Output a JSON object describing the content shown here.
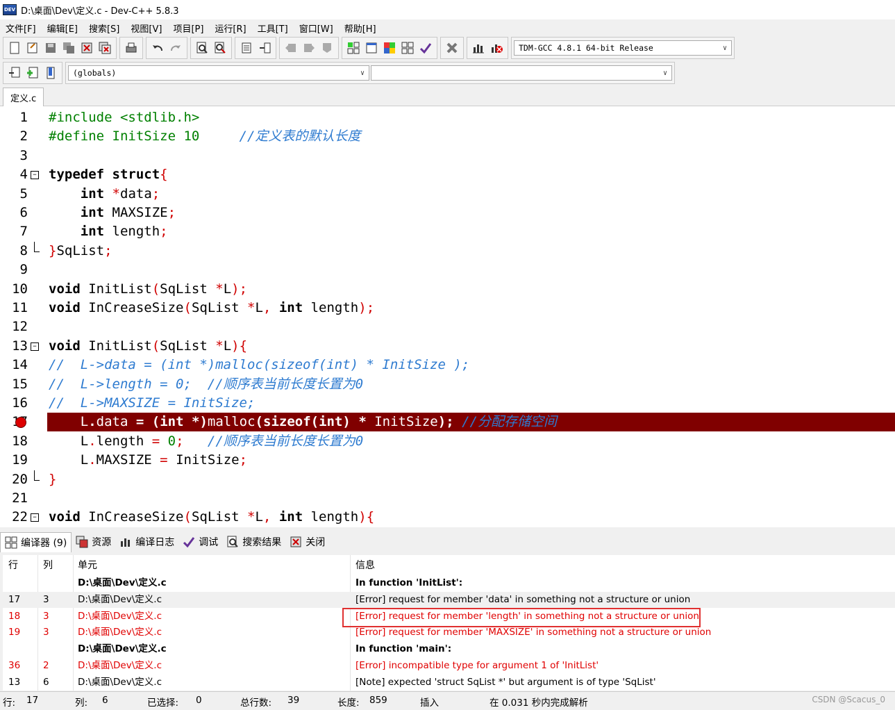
{
  "window": {
    "title": "D:\\桌面\\Dev\\定义.c - Dev-C++ 5.8.3",
    "icon_label": "DEV"
  },
  "menu": [
    "文件[F]",
    "编辑[E]",
    "搜索[S]",
    "视图[V]",
    "项目[P]",
    "运行[R]",
    "工具[T]",
    "窗口[W]",
    "帮助[H]"
  ],
  "toolbar": {
    "compiler_select": "TDM-GCC 4.8.1 64-bit Release",
    "scope_select": "(globals)",
    "member_select": ""
  },
  "file_tab": "定义.c",
  "editor": {
    "lines": [
      {
        "n": "1",
        "text": "#include <stdlib.h>"
      },
      {
        "n": "2",
        "text": "#define InitSize 10     //定义表的默认长度"
      },
      {
        "n": "3",
        "text": ""
      },
      {
        "n": "4",
        "text": "typedef struct{"
      },
      {
        "n": "5",
        "text": "    int *data;"
      },
      {
        "n": "6",
        "text": "    int MAXSIZE;"
      },
      {
        "n": "7",
        "text": "    int length;"
      },
      {
        "n": "8",
        "text": "}SqList;"
      },
      {
        "n": "9",
        "text": ""
      },
      {
        "n": "10",
        "text": "void InitList(SqList *L);"
      },
      {
        "n": "11",
        "text": "void InCreaseSize(SqList *L, int length);"
      },
      {
        "n": "12",
        "text": ""
      },
      {
        "n": "13",
        "text": "void InitList(SqList *L){"
      },
      {
        "n": "14",
        "text": "//  L->data = (int *)malloc(sizeof(int) * InitSize );"
      },
      {
        "n": "15",
        "text": "//  L->length = 0;  //顺序表当前长度长置为0"
      },
      {
        "n": "16",
        "text": "//  L->MAXSIZE = InitSize;"
      },
      {
        "n": "17",
        "text": "    L.data = (int *)malloc(sizeof(int) * InitSize); //分配存储空间"
      },
      {
        "n": "18",
        "text": "    L.length = 0;   //顺序表当前长度长置为0"
      },
      {
        "n": "19",
        "text": "    L.MAXSIZE = InitSize;"
      },
      {
        "n": "20",
        "text": "}"
      },
      {
        "n": "21",
        "text": ""
      },
      {
        "n": "22",
        "text": "void InCreaseSize(SqList *L, int length){"
      }
    ],
    "error_line": "17"
  },
  "bottom_tabs": [
    "编译器 (9)",
    "资源",
    "编译日志",
    "调试",
    "搜索结果",
    "关闭"
  ],
  "messages": {
    "headers": [
      "行",
      "列",
      "单元",
      "信息"
    ],
    "rows": [
      {
        "row": "",
        "col": "",
        "unit": "D:\\桌面\\Dev\\定义.c",
        "msg": "In function 'InitList':",
        "style": "bold"
      },
      {
        "row": "17",
        "col": "3",
        "unit": "D:\\桌面\\Dev\\定义.c",
        "msg": "[Error] request for member 'data' in something not a structure or union",
        "style": "normal"
      },
      {
        "row": "18",
        "col": "3",
        "unit": "D:\\桌面\\Dev\\定义.c",
        "msg": "[Error] request for member 'length' in something not a structure or union",
        "style": "red"
      },
      {
        "row": "19",
        "col": "3",
        "unit": "D:\\桌面\\Dev\\定义.c",
        "msg": "[Error] request for member 'MAXSIZE' in something not a structure or union",
        "style": "red"
      },
      {
        "row": "",
        "col": "",
        "unit": "D:\\桌面\\Dev\\定义.c",
        "msg": "In function 'main':",
        "style": "bold"
      },
      {
        "row": "36",
        "col": "2",
        "unit": "D:\\桌面\\Dev\\定义.c",
        "msg": "[Error] incompatible type for argument 1 of 'InitList'",
        "style": "red"
      },
      {
        "row": "13",
        "col": "6",
        "unit": "D:\\桌面\\Dev\\定义.c",
        "msg": "[Note] expected 'struct SqList *' but argument is of type 'SqList'",
        "style": "normal"
      }
    ]
  },
  "status": {
    "row_label": "行:",
    "row": "17",
    "col_label": "列:",
    "col": "6",
    "sel_label": "已选择:",
    "sel": "0",
    "total_label": "总行数:",
    "total": "39",
    "len_label": "长度:",
    "len": "859",
    "mode": "插入",
    "parse": "在 0.031 秒内完成解析"
  },
  "watermark": "CSDN @Scacus_0"
}
